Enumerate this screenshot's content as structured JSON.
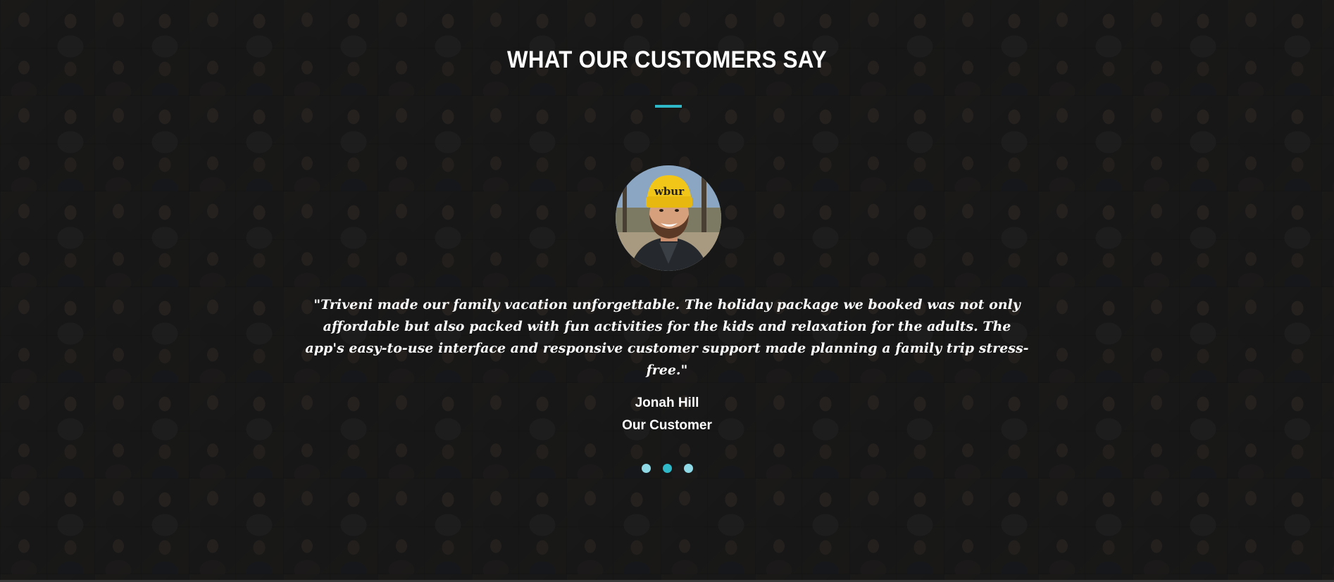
{
  "section": {
    "title": "WHAT OUR CUSTOMERS SAY",
    "accent_color": "#2fb8c8"
  },
  "testimonial": {
    "avatar": "customer-photo",
    "avatar_hat_text": "wbur",
    "quote": "\"Triveni made our family vacation unforgettable. The holiday package we booked was not only affordable but also packed with fun activities for the kids and relaxation for the adults. The app's easy-to-use interface and responsive customer support made planning a family trip stress-free.\"",
    "name": "Jonah Hill",
    "role": "Our Customer"
  },
  "carousel": {
    "dots": [
      {
        "active": false
      },
      {
        "active": true
      },
      {
        "active": false
      }
    ]
  }
}
